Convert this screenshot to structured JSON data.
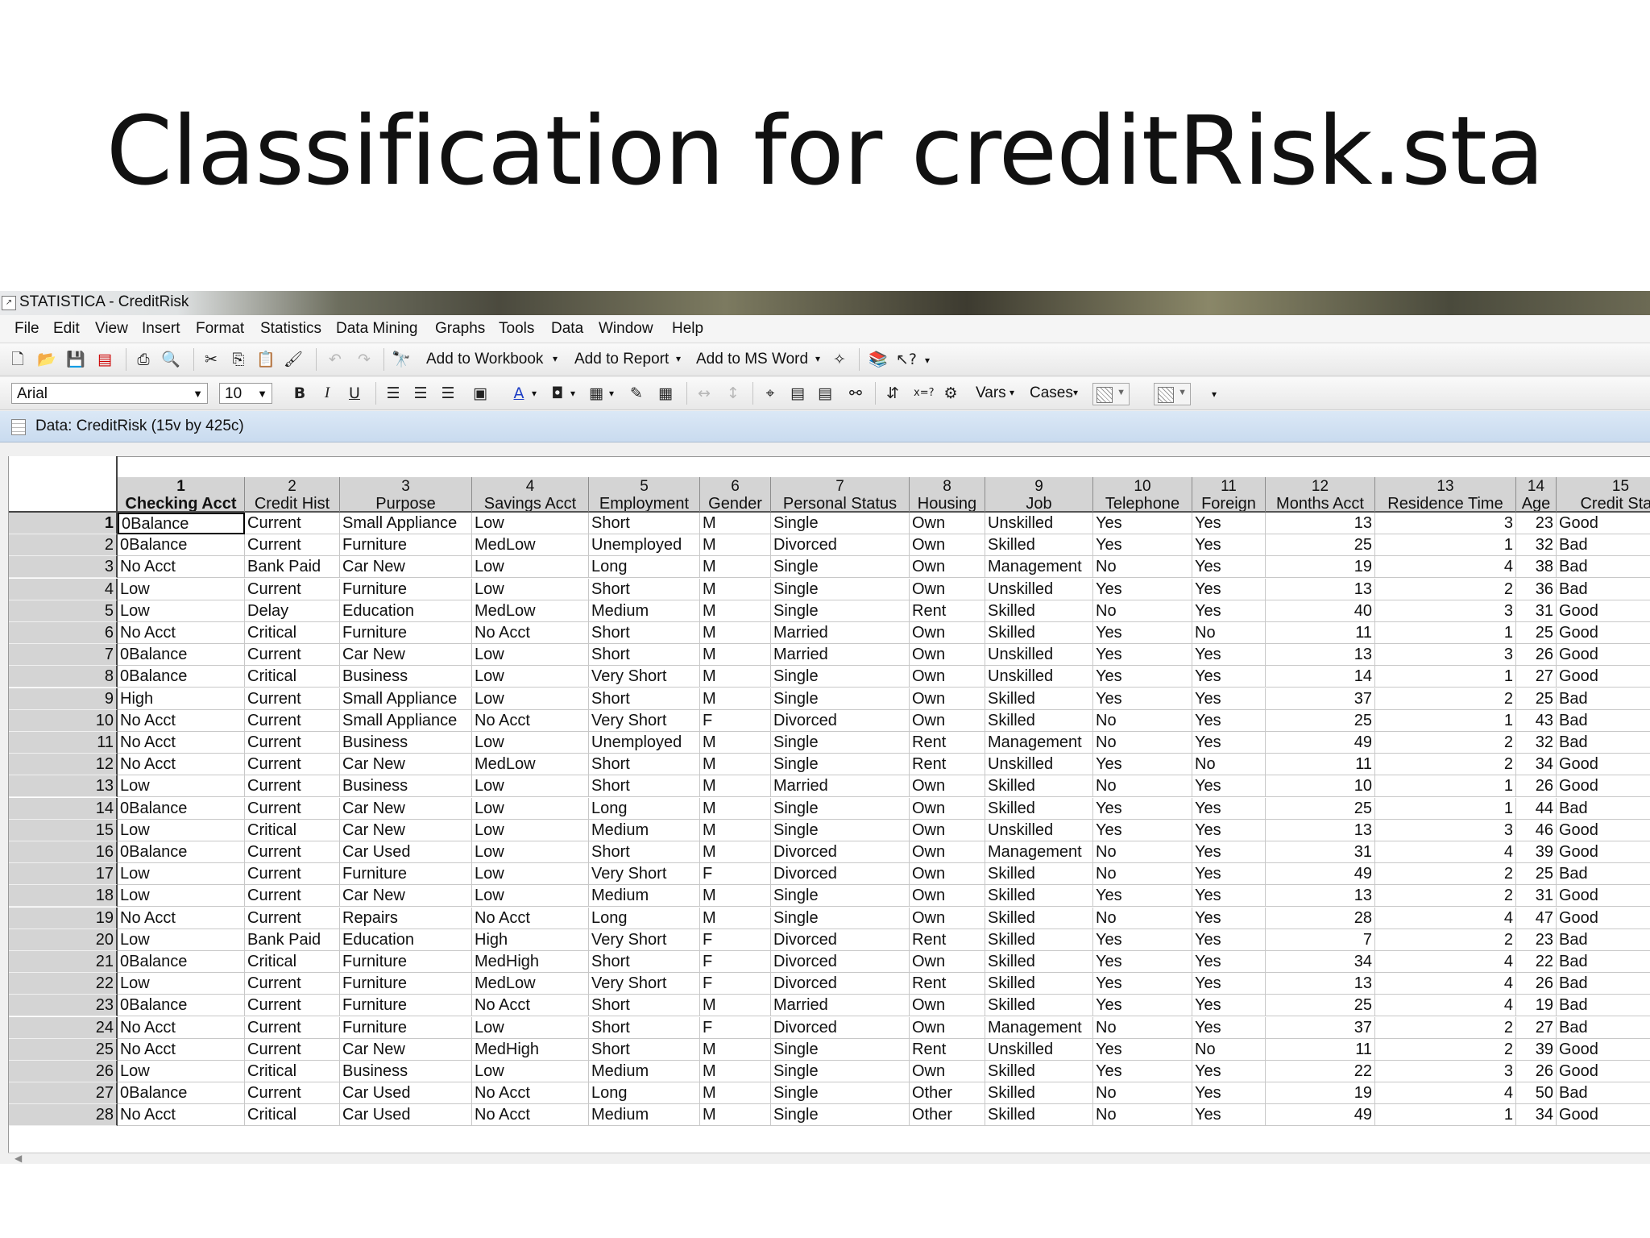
{
  "slide_title": "Classification for creditRisk.sta",
  "window": {
    "title": "STATISTICA - CreditRisk",
    "app_icon": "statistica-icon"
  },
  "menu": [
    "File",
    "Edit",
    "View",
    "Insert",
    "Format",
    "Statistics",
    "Data Mining",
    "Graphs",
    "Tools",
    "Data",
    "Window",
    "Help"
  ],
  "toolbar1": {
    "add_to_workbook": "Add to Workbook",
    "add_to_report": "Add to Report",
    "add_to_ms_word": "Add to MS Word"
  },
  "toolbar2": {
    "font": "Arial",
    "size": "10",
    "vars": "Vars",
    "cases": "Cases"
  },
  "doc": {
    "title": "Data: CreditRisk (15v by 425c)"
  },
  "columns": [
    {
      "num": "1",
      "name": "Checking Acct"
    },
    {
      "num": "2",
      "name": "Credit Hist"
    },
    {
      "num": "3",
      "name": "Purpose"
    },
    {
      "num": "4",
      "name": "Savings Acct"
    },
    {
      "num": "5",
      "name": "Employment"
    },
    {
      "num": "6",
      "name": "Gender"
    },
    {
      "num": "7",
      "name": "Personal Status"
    },
    {
      "num": "8",
      "name": "Housing"
    },
    {
      "num": "9",
      "name": "Job"
    },
    {
      "num": "10",
      "name": "Telephone"
    },
    {
      "num": "11",
      "name": "Foreign"
    },
    {
      "num": "12",
      "name": "Months Acct"
    },
    {
      "num": "13",
      "name": "Residence Time"
    },
    {
      "num": "14",
      "name": "Age"
    },
    {
      "num": "15",
      "name": "Credit Stan"
    }
  ],
  "rows": [
    [
      "0Balance",
      "Current",
      "Small Appliance",
      "Low",
      "Short",
      "M",
      "Single",
      "Own",
      "Unskilled",
      "Yes",
      "Yes",
      "13",
      "3",
      "23",
      "Good"
    ],
    [
      "0Balance",
      "Current",
      "Furniture",
      "MedLow",
      "Unemployed",
      "M",
      "Divorced",
      "Own",
      "Skilled",
      "Yes",
      "Yes",
      "25",
      "1",
      "32",
      "Bad"
    ],
    [
      "No Acct",
      "Bank Paid",
      "Car New",
      "Low",
      "Long",
      "M",
      "Single",
      "Own",
      "Management",
      "No",
      "Yes",
      "19",
      "4",
      "38",
      "Bad"
    ],
    [
      "Low",
      "Current",
      "Furniture",
      "Low",
      "Short",
      "M",
      "Single",
      "Own",
      "Unskilled",
      "Yes",
      "Yes",
      "13",
      "2",
      "36",
      "Bad"
    ],
    [
      "Low",
      "Delay",
      "Education",
      "MedLow",
      "Medium",
      "M",
      "Single",
      "Rent",
      "Skilled",
      "No",
      "Yes",
      "40",
      "3",
      "31",
      "Good"
    ],
    [
      "No Acct",
      "Critical",
      "Furniture",
      "No Acct",
      "Short",
      "M",
      "Married",
      "Own",
      "Skilled",
      "Yes",
      "No",
      "11",
      "1",
      "25",
      "Good"
    ],
    [
      "0Balance",
      "Current",
      "Car New",
      "Low",
      "Short",
      "M",
      "Married",
      "Own",
      "Unskilled",
      "Yes",
      "Yes",
      "13",
      "3",
      "26",
      "Good"
    ],
    [
      "0Balance",
      "Critical",
      "Business",
      "Low",
      "Very Short",
      "M",
      "Single",
      "Own",
      "Unskilled",
      "Yes",
      "Yes",
      "14",
      "1",
      "27",
      "Good"
    ],
    [
      "High",
      "Current",
      "Small Appliance",
      "Low",
      "Short",
      "M",
      "Single",
      "Own",
      "Skilled",
      "Yes",
      "Yes",
      "37",
      "2",
      "25",
      "Bad"
    ],
    [
      "No Acct",
      "Current",
      "Small Appliance",
      "No Acct",
      "Very Short",
      "F",
      "Divorced",
      "Own",
      "Skilled",
      "No",
      "Yes",
      "25",
      "1",
      "43",
      "Bad"
    ],
    [
      "No Acct",
      "Current",
      "Business",
      "Low",
      "Unemployed",
      "M",
      "Single",
      "Rent",
      "Management",
      "No",
      "Yes",
      "49",
      "2",
      "32",
      "Bad"
    ],
    [
      "No Acct",
      "Current",
      "Car New",
      "MedLow",
      "Short",
      "M",
      "Single",
      "Rent",
      "Unskilled",
      "Yes",
      "No",
      "11",
      "2",
      "34",
      "Good"
    ],
    [
      "Low",
      "Current",
      "Business",
      "Low",
      "Short",
      "M",
      "Married",
      "Own",
      "Skilled",
      "No",
      "Yes",
      "10",
      "1",
      "26",
      "Good"
    ],
    [
      "0Balance",
      "Current",
      "Car New",
      "Low",
      "Long",
      "M",
      "Single",
      "Own",
      "Skilled",
      "Yes",
      "Yes",
      "25",
      "1",
      "44",
      "Bad"
    ],
    [
      "Low",
      "Critical",
      "Car New",
      "Low",
      "Medium",
      "M",
      "Single",
      "Own",
      "Unskilled",
      "Yes",
      "Yes",
      "13",
      "3",
      "46",
      "Good"
    ],
    [
      "0Balance",
      "Current",
      "Car Used",
      "Low",
      "Short",
      "M",
      "Divorced",
      "Own",
      "Management",
      "No",
      "Yes",
      "31",
      "4",
      "39",
      "Good"
    ],
    [
      "Low",
      "Current",
      "Furniture",
      "Low",
      "Very Short",
      "F",
      "Divorced",
      "Own",
      "Skilled",
      "No",
      "Yes",
      "49",
      "2",
      "25",
      "Bad"
    ],
    [
      "Low",
      "Current",
      "Car New",
      "Low",
      "Medium",
      "M",
      "Single",
      "Own",
      "Skilled",
      "Yes",
      "Yes",
      "13",
      "2",
      "31",
      "Good"
    ],
    [
      "No Acct",
      "Current",
      "Repairs",
      "No Acct",
      "Long",
      "M",
      "Single",
      "Own",
      "Skilled",
      "No",
      "Yes",
      "28",
      "4",
      "47",
      "Good"
    ],
    [
      "Low",
      "Bank Paid",
      "Education",
      "High",
      "Very Short",
      "F",
      "Divorced",
      "Rent",
      "Skilled",
      "Yes",
      "Yes",
      "7",
      "2",
      "23",
      "Bad"
    ],
    [
      "0Balance",
      "Critical",
      "Furniture",
      "MedHigh",
      "Short",
      "F",
      "Divorced",
      "Own",
      "Skilled",
      "Yes",
      "Yes",
      "34",
      "4",
      "22",
      "Bad"
    ],
    [
      "Low",
      "Current",
      "Furniture",
      "MedLow",
      "Very Short",
      "F",
      "Divorced",
      "Rent",
      "Skilled",
      "Yes",
      "Yes",
      "13",
      "4",
      "26",
      "Bad"
    ],
    [
      "0Balance",
      "Current",
      "Furniture",
      "No Acct",
      "Short",
      "M",
      "Married",
      "Own",
      "Skilled",
      "Yes",
      "Yes",
      "25",
      "4",
      "19",
      "Bad"
    ],
    [
      "No Acct",
      "Current",
      "Furniture",
      "Low",
      "Short",
      "F",
      "Divorced",
      "Own",
      "Management",
      "No",
      "Yes",
      "37",
      "2",
      "27",
      "Bad"
    ],
    [
      "No Acct",
      "Current",
      "Car New",
      "MedHigh",
      "Short",
      "M",
      "Single",
      "Rent",
      "Unskilled",
      "Yes",
      "No",
      "11",
      "2",
      "39",
      "Good"
    ],
    [
      "Low",
      "Critical",
      "Business",
      "Low",
      "Medium",
      "M",
      "Single",
      "Own",
      "Skilled",
      "Yes",
      "Yes",
      "22",
      "3",
      "26",
      "Good"
    ],
    [
      "0Balance",
      "Current",
      "Car Used",
      "No Acct",
      "Long",
      "M",
      "Single",
      "Other",
      "Skilled",
      "No",
      "Yes",
      "19",
      "4",
      "50",
      "Bad"
    ],
    [
      "No Acct",
      "Critical",
      "Car Used",
      "No Acct",
      "Medium",
      "M",
      "Single",
      "Other",
      "Skilled",
      "No",
      "Yes",
      "49",
      "1",
      "34",
      "Good"
    ]
  ],
  "numeric_columns": [
    11,
    12,
    13
  ]
}
